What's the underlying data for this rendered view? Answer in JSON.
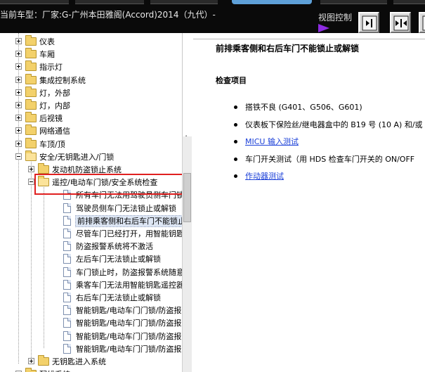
{
  "header": {
    "vehicle_label": "当前车型：厂家:G-广州本田雅阁(Accord)2014（九代）-",
    "view_control_label": "视图控制",
    "view_arrow_icon": "play-arrow-icon",
    "buttons": [
      {
        "name": "collapse-left-button",
        "icon": "arrow-right-bar-icon"
      },
      {
        "name": "split-view-button",
        "icon": "double-arrow-icon"
      },
      {
        "name": "expand-right-button",
        "icon": "arrow-left-bar-icon"
      }
    ]
  },
  "tree": {
    "items": [
      {
        "label": "仪表",
        "type": "folder",
        "expander": "plus"
      },
      {
        "label": "车厢",
        "type": "folder",
        "expander": "plus"
      },
      {
        "label": "指示灯",
        "type": "folder",
        "expander": "plus"
      },
      {
        "label": "集成控制系统",
        "type": "folder",
        "expander": "plus"
      },
      {
        "label": "灯，外部",
        "type": "folder",
        "expander": "plus"
      },
      {
        "label": "灯，内部",
        "type": "folder",
        "expander": "plus"
      },
      {
        "label": "后视镜",
        "type": "folder",
        "expander": "plus"
      },
      {
        "label": "网络通信",
        "type": "folder",
        "expander": "plus"
      },
      {
        "label": "车顶/顶",
        "type": "folder",
        "expander": "plus"
      },
      {
        "label": "安全/无钥匙进入/门锁",
        "type": "folder-open",
        "expander": "minus"
      },
      {
        "label": "发动机防盗锁止系统",
        "type": "folder",
        "expander": "plus"
      },
      {
        "label": "遥控/电动车门锁/安全系统检查",
        "type": "folder-open",
        "expander": "minus"
      },
      {
        "label": "所有车门无法用驾驶员侧车门锁芯",
        "type": "doc"
      },
      {
        "label": "驾驶员侧车门无法锁止或解锁",
        "type": "doc"
      },
      {
        "label": "前排乘客侧和右后车门不能锁止或",
        "type": "doc",
        "selected": true
      },
      {
        "label": "尽管车门已经打开，用智能钥匙遥",
        "type": "doc"
      },
      {
        "label": "防盗报警系统将不激活",
        "type": "doc"
      },
      {
        "label": "左后车门无法锁止或解锁",
        "type": "doc"
      },
      {
        "label": "车门锁止时，防盗报警系统随意鸣",
        "type": "doc"
      },
      {
        "label": "乘客车门无法用智能钥匙遥控器或",
        "type": "doc"
      },
      {
        "label": "右后车门无法锁止或解锁",
        "type": "doc"
      },
      {
        "label": "智能钥匙/电动车门门锁/防盗报警",
        "type": "doc"
      },
      {
        "label": "智能钥匙/电动车门门锁/防盗报警",
        "type": "doc"
      },
      {
        "label": "智能钥匙/电动车门门锁/防盗报警",
        "type": "doc"
      },
      {
        "label": "智能钥匙/电动车门门锁/防盗报警",
        "type": "doc"
      },
      {
        "label": "无钥匙进入系统",
        "type": "folder",
        "expander": "plus"
      },
      {
        "label": "配线系统",
        "type": "folder",
        "expander": "plus"
      }
    ]
  },
  "content": {
    "title": "前排乘客侧和右后车门不能锁止或解锁",
    "section_heading": "检查项目",
    "checks": [
      {
        "text": "搭铁不良 (G401、G506、G601)",
        "link": false
      },
      {
        "text": "仪表板下保险丝/继电器盒中的 B19 号 (10 A) 和/或",
        "link": false
      },
      {
        "text": "MICU 输入测试",
        "link": true
      },
      {
        "text": "车门开关测试（用 HDS 检查车门开关的 ON/OFF",
        "link": false
      },
      {
        "text": "作动器测试",
        "link": true
      }
    ]
  },
  "colors": {
    "header_bg": "#0a0a0a",
    "highlight_box": "#e02020",
    "link": "#1a3fd8",
    "view_arrow": "#8d2be2"
  }
}
